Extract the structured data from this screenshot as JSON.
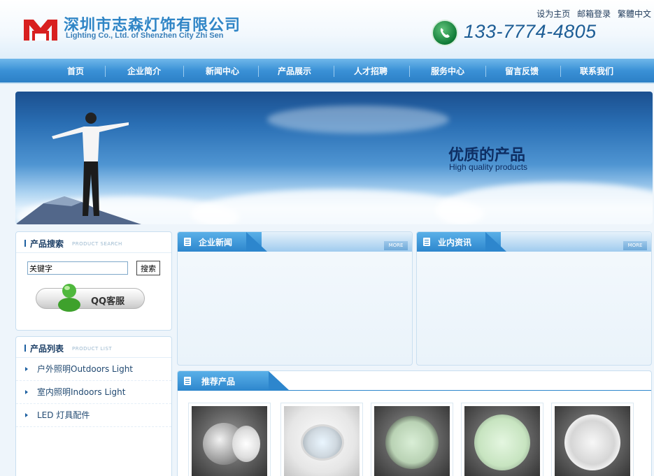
{
  "header": {
    "company_cn": "深圳市志森灯饰有限公司",
    "company_en": "Lighting Co., Ltd. of Shenzhen City Zhi Sen",
    "phone": "133-7774-4805",
    "toplinks": [
      "设为主页",
      "邮箱登录",
      "繁體中文"
    ]
  },
  "nav": {
    "items": [
      "首页",
      "企业简介",
      "新闻中心",
      "产品展示",
      "人才招聘",
      "服务中心",
      "留言反馈",
      "联系我们"
    ]
  },
  "banner": {
    "title": "优质的产品",
    "subtitle": "High quality products"
  },
  "search_box": {
    "title_cn": "产品搜索",
    "title_en": "PRODUCT SEARCH",
    "input_value": "关键字",
    "button_label": "搜索",
    "qq_label": "QQ客服"
  },
  "product_list": {
    "title_cn": "产品列表",
    "title_en": "PRODUCT LIST",
    "items": [
      "户外照明Outdoors Light",
      "室内照明Indoors Light",
      "LED 灯具配件"
    ]
  },
  "panels": {
    "news": {
      "title": "企业新闻",
      "more": "MORE"
    },
    "industry": {
      "title": "业内资讯",
      "more": "MORE"
    }
  },
  "recommended": {
    "title": "推荐产品"
  },
  "colors": {
    "nav": "#2c80c6",
    "accent": "#2d86cd",
    "logo_red": "#d8201f"
  }
}
